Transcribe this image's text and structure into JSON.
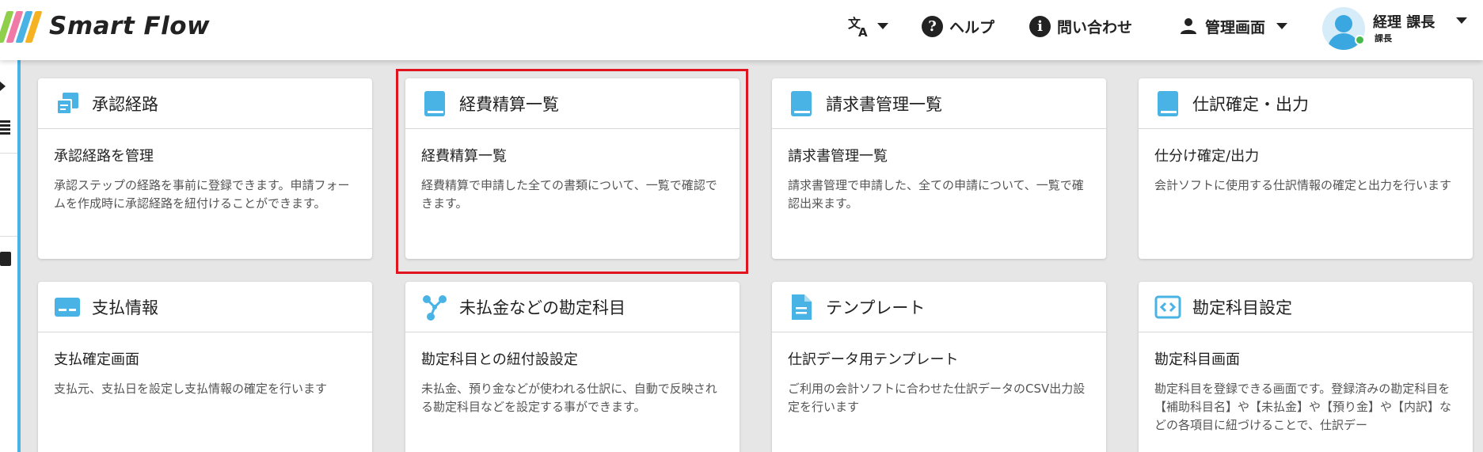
{
  "app": {
    "name": "Smart Flow",
    "logo_colors": [
      "#8fcf4a",
      "#f07aa6",
      "#4ab3e6",
      "#f5b324"
    ]
  },
  "header": {
    "translate_icon": "translate-icon",
    "help_label": "ヘルプ",
    "contact_label": "問い合わせ",
    "admin_label": "管理画面",
    "user_name": "経理 課長",
    "user_role": "課長",
    "status_color": "#46b94a"
  },
  "accent_color": "#4ab3e6",
  "highlight_color": "#e0141e",
  "cards": [
    {
      "icon": "copy-stack-icon",
      "title": "承認経路",
      "sub": "承認経路を管理",
      "desc": "承認ステップの経路を事前に登録できます。申請フォームを作成時に承認経路を紐付けることができます。"
    },
    {
      "icon": "book-icon",
      "title": "経費精算一覧",
      "sub": "経費精算一覧",
      "desc": "経費精算で申請した全ての書類について、一覧で確認できます。",
      "highlighted": true
    },
    {
      "icon": "book-icon",
      "title": "請求書管理一覧",
      "sub": "請求書管理一覧",
      "desc": "請求書管理で申請した、全ての申請について、一覧で確認出来ます。"
    },
    {
      "icon": "book-icon",
      "title": "仕訳確定・出力",
      "sub": "仕分け確定/出力",
      "desc": "会計ソフトに使用する仕訳情報の確定と出力を行います"
    },
    {
      "icon": "card-icon",
      "title": "支払情報",
      "sub": "支払確定画面",
      "desc": "支払元、支払日を設定し支払情報の確定を行います"
    },
    {
      "icon": "network-icon",
      "title": "未払金などの勘定科目",
      "sub": "勘定科目との紐付設設定",
      "desc": "未払金、預り金などが使われる仕訳に、自動で反映される勘定科目などを設定する事ができます。"
    },
    {
      "icon": "document-icon",
      "title": "テンプレート",
      "sub": "仕訳データ用テンプレート",
      "desc": "ご利用の会計ソフトに合わせた仕訳データのCSV出力設定を行います"
    },
    {
      "icon": "code-icon",
      "title": "勘定科目設定",
      "sub": "勘定科目画面",
      "desc": "勘定科目を登録できる画面です。登録済みの勘定科目を【補助科目名】や【未払金】や【預り金】や【内訳】などの各項目に紐づけることで、仕訳デー"
    }
  ]
}
